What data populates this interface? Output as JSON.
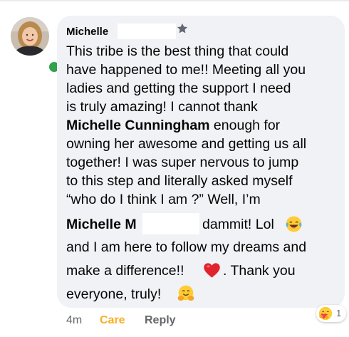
{
  "comment": {
    "author_name": "Michelle",
    "lines": {
      "l1": "This tribe is the best thing that could",
      "l2": "have happened to me!! Meeting all you",
      "l3": "ladies and getting the support I need",
      "l4": "is truly amazing! I cannot thank",
      "l5_bold": "Michelle Cunningham",
      "l5_rest": " enough for",
      "l6": "owning her awesome and getting us all",
      "l7": "together! I was super nervous to jump",
      "l8": "to this step and literally asked myself",
      "l9": "“who do I think I am ?” Well, I’m",
      "l10_bold": "Michelle M",
      "l10_rest": "dammit! Lol",
      "l11": "and I am here to follow my dreams and",
      "l12": "make a difference!!",
      "l12_rest": ". Thank you",
      "l13": "everyone, truly!"
    }
  },
  "footer": {
    "time": "4m",
    "care": "Care",
    "reply": "Reply"
  },
  "reaction": {
    "type": "care",
    "count": "1"
  },
  "icons": {
    "star": "star-icon",
    "laugh_emoji": "laughing-tears-emoji",
    "heart_emoji": "red-heart-emoji",
    "hug_emoji": "hugging-face-emoji",
    "care_reaction": "care-reaction-icon"
  },
  "colors": {
    "bubble": "#f0f2f5",
    "care": "#f7b125",
    "meta": "#65676b",
    "presence": "#31a24c"
  }
}
